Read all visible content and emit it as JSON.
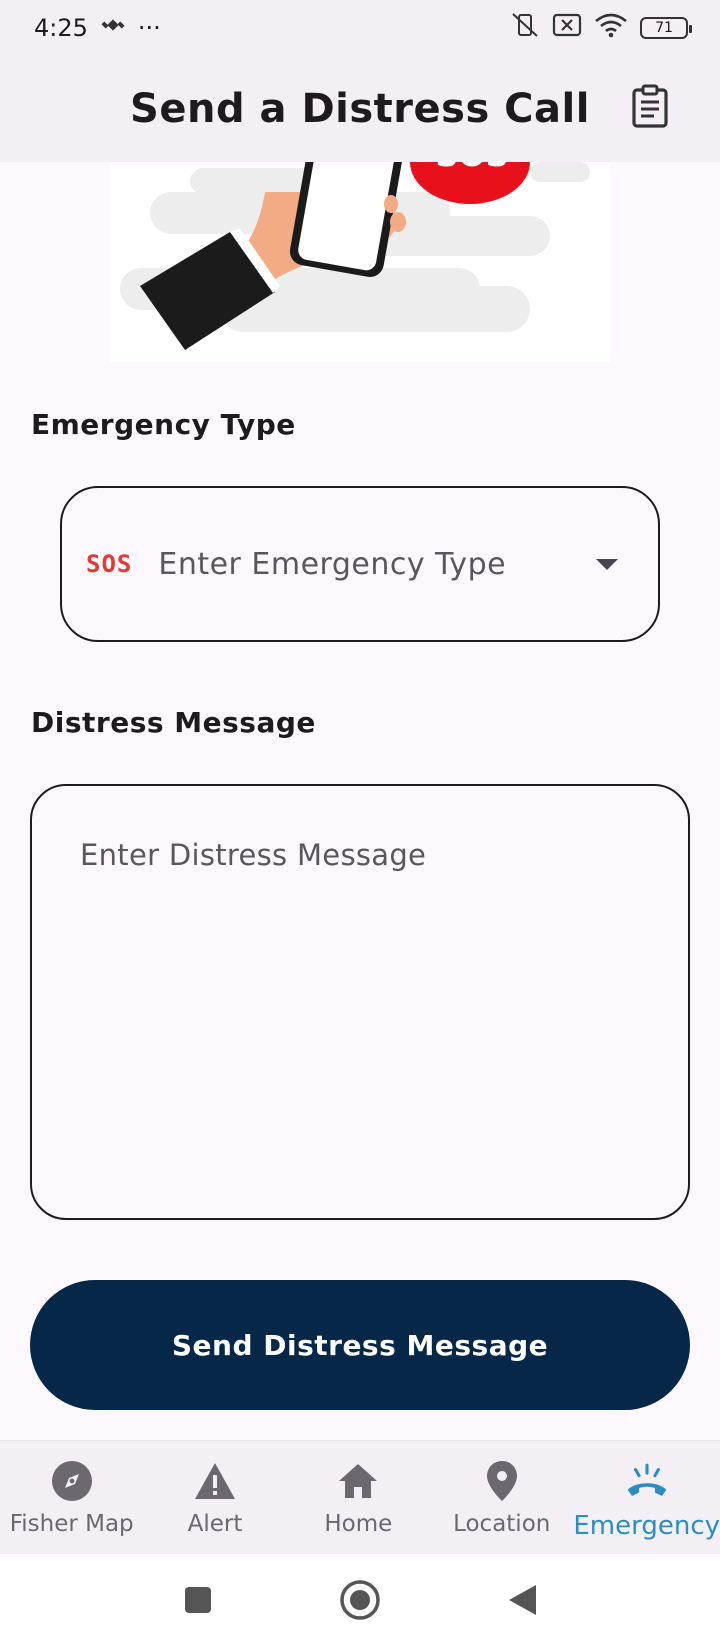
{
  "status_bar": {
    "time": "4:25",
    "dots": "···",
    "battery_level": "71"
  },
  "app_bar": {
    "title": "Send a Distress Call",
    "action_icon": "clipboard-list-icon"
  },
  "form": {
    "emergency_type_label": "Emergency Type",
    "emergency_type_icon_text": "SOS",
    "emergency_type_placeholder": "Enter Emergency Type",
    "distress_message_label": "Distress Message",
    "distress_message_placeholder": "Enter Distress Message",
    "send_button_label": "Send Distress Message"
  },
  "bottom_nav": {
    "items": [
      {
        "label": "Fisher Map",
        "icon": "compass-icon",
        "active": false
      },
      {
        "label": "Alert",
        "icon": "warning-icon",
        "active": false
      },
      {
        "label": "Home",
        "icon": "home-icon",
        "active": false
      },
      {
        "label": "Location",
        "icon": "location-pin-icon",
        "active": false
      },
      {
        "label": "Emergency",
        "icon": "phone-ringing-icon",
        "active": true
      }
    ]
  },
  "colors": {
    "accent": "#2c8ebf",
    "button": "#062747",
    "sos_red": "#e53935"
  }
}
